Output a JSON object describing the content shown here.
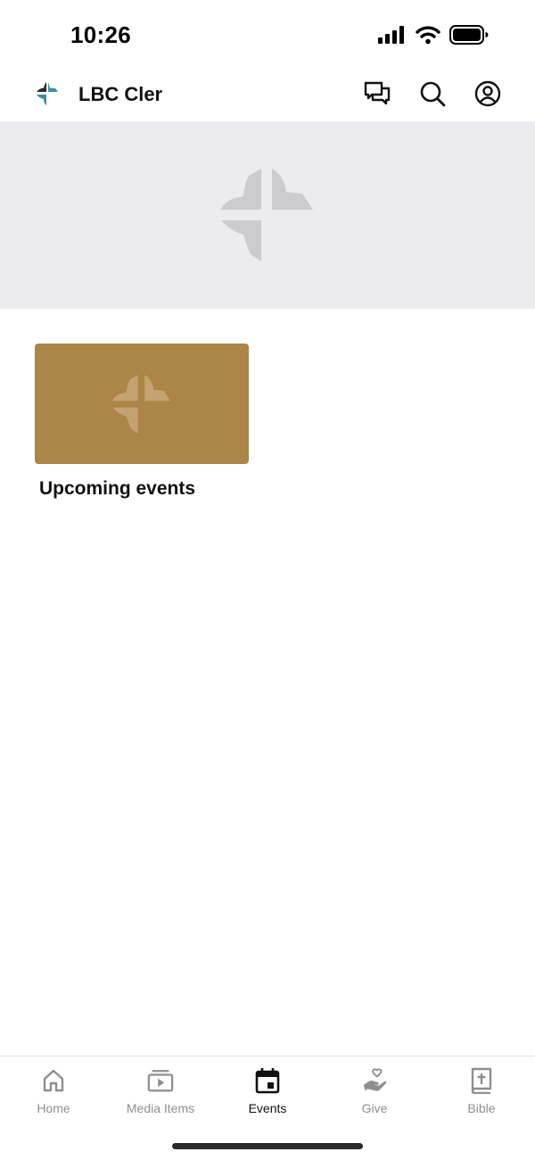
{
  "status_bar": {
    "time": "10:26"
  },
  "header": {
    "title": "LBC Cler"
  },
  "colors": {
    "accent_gold": "#ab8647",
    "hero_bg": "#ececee",
    "logo_dark": "#2b2b2b",
    "logo_teal": "#3e8fa6"
  },
  "hero": {
    "icon": "church-cross-logo-icon"
  },
  "cards": [
    {
      "title": "Upcoming events",
      "icon": "church-cross-logo-icon"
    }
  ],
  "tabs": [
    {
      "label": "Home",
      "icon": "home-icon",
      "active": false
    },
    {
      "label": "Media Items",
      "icon": "media-play-icon",
      "active": false
    },
    {
      "label": "Events",
      "icon": "calendar-icon",
      "active": true
    },
    {
      "label": "Give",
      "icon": "give-heart-hand-icon",
      "active": false
    },
    {
      "label": "Bible",
      "icon": "bible-icon",
      "active": false
    }
  ]
}
